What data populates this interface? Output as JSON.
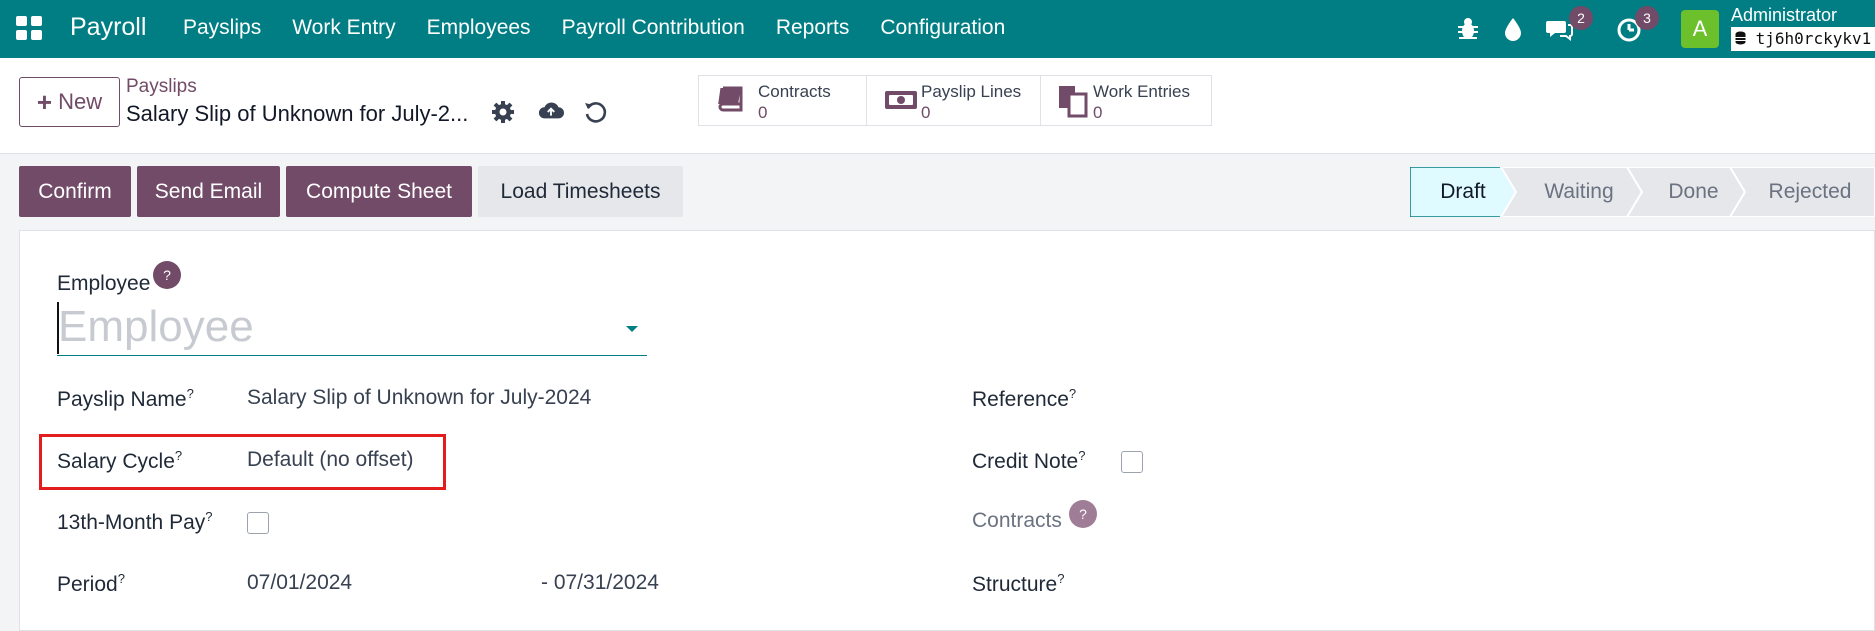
{
  "nav": {
    "brand": "Payroll",
    "menu": [
      "Payslips",
      "Work Entry",
      "Employees",
      "Payroll Contribution",
      "Reports",
      "Configuration"
    ],
    "messages_count": "2",
    "activities_count": "3",
    "user_initial": "A",
    "user_name": "Administrator",
    "database": "tj6h0rckykv1"
  },
  "control": {
    "new_label": "New",
    "breadcrumb": "Payslips",
    "record_title": "Salary Slip of Unknown for July-2...",
    "smart_buttons": [
      {
        "label": "Contracts",
        "count": "0"
      },
      {
        "label": "Payslip Lines",
        "count": "0"
      },
      {
        "label": "Work Entries",
        "count": "0"
      }
    ]
  },
  "actions": {
    "confirm": "Confirm",
    "send_email": "Send Email",
    "compute_sheet": "Compute Sheet",
    "load_timesheets": "Load Timesheets"
  },
  "statusbar": {
    "stages": [
      "Draft",
      "Waiting",
      "Done",
      "Rejected"
    ],
    "active": "Draft"
  },
  "form": {
    "employee_label": "Employee",
    "employee_placeholder": "Employee",
    "help_mark": "?",
    "payslip_name_label": "Payslip Name",
    "payslip_name_value": "Salary Slip of Unknown for July-2024",
    "salary_cycle_label": "Salary Cycle",
    "salary_cycle_value": "Default (no offset)",
    "thirteenth_month_label": "13th-Month Pay",
    "period_label": "Period",
    "period_from": "07/01/2024",
    "period_to": "- 07/31/2024",
    "reference_label": "Reference",
    "credit_note_label": "Credit Note",
    "contracts_label": "Contracts",
    "structure_label": "Structure"
  },
  "colors": {
    "navbar": "#017e84",
    "primary": "#714b67",
    "highlight": "#e11d1d",
    "status_active": "#e0fbff"
  }
}
